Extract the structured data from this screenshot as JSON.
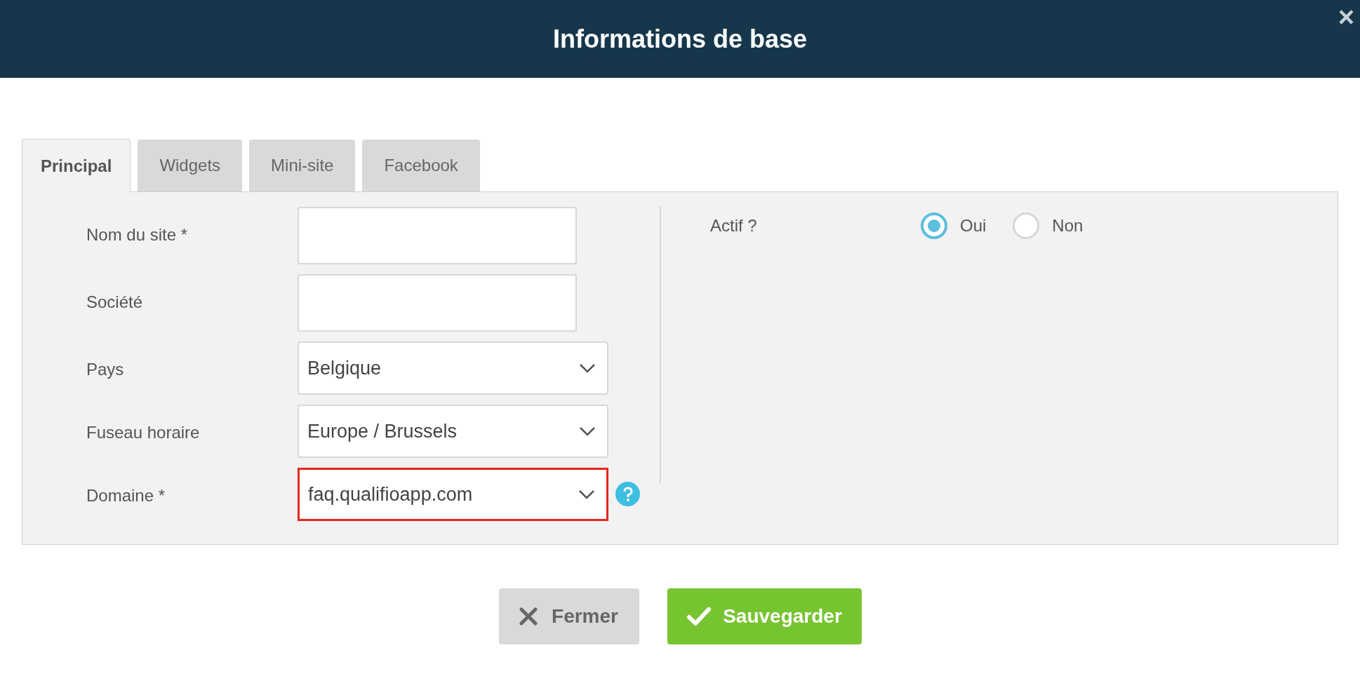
{
  "dialog": {
    "title": "Informations de base",
    "close": "×"
  },
  "tabs": [
    {
      "label": "Principal",
      "selected": true
    },
    {
      "label": "Widgets",
      "selected": false
    },
    {
      "label": "Mini-site",
      "selected": false
    },
    {
      "label": "Facebook",
      "selected": false
    }
  ],
  "fields": [
    {
      "label": "Nom du site *",
      "kind": "text",
      "highlighted": false,
      "help": false
    },
    {
      "label": "Société",
      "kind": "text",
      "highlighted": false,
      "help": false
    },
    {
      "label": "Pays",
      "kind": "select",
      "value": "Belgique",
      "highlighted": false,
      "help": false
    },
    {
      "label": "Fuseau horaire",
      "kind": "select",
      "value": "Europe / Brussels",
      "highlighted": false,
      "help": false
    },
    {
      "label": "Domaine *",
      "kind": "select",
      "value": "faq.qualifioapp.com",
      "highlighted": true,
      "help": true
    }
  ],
  "actif": {
    "label": "Actif ?",
    "options": [
      {
        "label": "Oui",
        "selected": true
      },
      {
        "label": "Non",
        "selected": false
      }
    ]
  },
  "buttons": [
    {
      "label": "Fermer",
      "kind": "close"
    },
    {
      "label": "Sauvegarder",
      "kind": "save"
    }
  ]
}
